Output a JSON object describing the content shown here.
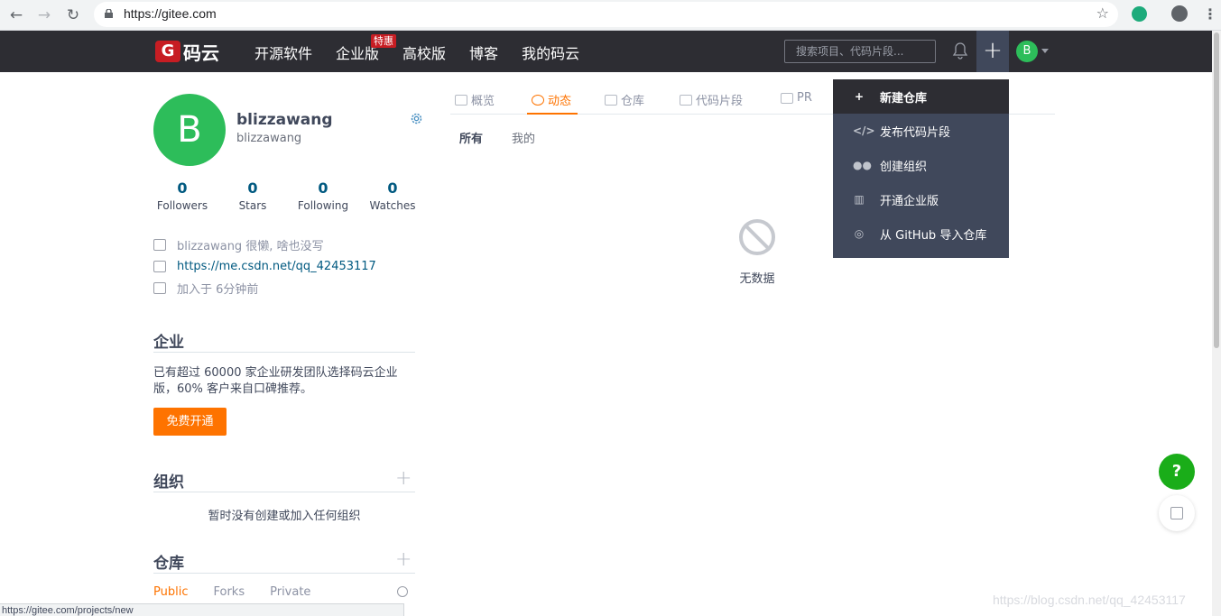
{
  "browser": {
    "url": "https://gitee.com",
    "status_url": "https://gitee.com/projects/new"
  },
  "header": {
    "logo_mark": "G",
    "logo_text": "码云",
    "nav": [
      "开源软件",
      "企业版",
      "高校版",
      "博客",
      "我的码云"
    ],
    "badge": "特惠",
    "search_placeholder": "搜索项目、代码片段...",
    "avatar_letter": "B"
  },
  "profile": {
    "avatar_letter": "B",
    "name": "blizzawang",
    "login": "blizzawang",
    "stats": [
      {
        "num": "0",
        "label": "Followers"
      },
      {
        "num": "0",
        "label": "Stars"
      },
      {
        "num": "0",
        "label": "Following"
      },
      {
        "num": "0",
        "label": "Watches"
      }
    ],
    "bio": "blizzawang 很懒, 啥也没写",
    "link": "https://me.csdn.net/qq_42453117",
    "joined": "加入于 6分钟前"
  },
  "enterprise": {
    "title": "企业",
    "desc": "已有超过 60000 家企业研发团队选择码云企业版，60% 客户来自口碑推荐。",
    "button": "免费开通"
  },
  "orgs": {
    "title": "组织",
    "empty": "暂时没有创建或加入任何组织"
  },
  "repos": {
    "title": "仓库",
    "tabs": [
      "Public",
      "Forks",
      "Private"
    ]
  },
  "main": {
    "tabs": [
      "概览",
      "动态",
      "仓库",
      "代码片段",
      "PR"
    ],
    "subtabs": [
      "所有",
      "我的"
    ],
    "empty": "无数据"
  },
  "dropdown": {
    "items": [
      {
        "icon": "+",
        "label": "新建仓库"
      },
      {
        "icon": "</>",
        "label": "发布代码片段"
      },
      {
        "icon": "●●",
        "label": "创建组织"
      },
      {
        "icon": "▥",
        "label": "开通企业版"
      },
      {
        "icon": "◎",
        "label": "从 GitHub 导入仓库"
      }
    ]
  },
  "floating": {
    "help": "?"
  },
  "watermark": "https://blog.csdn.net/qq_42453117"
}
